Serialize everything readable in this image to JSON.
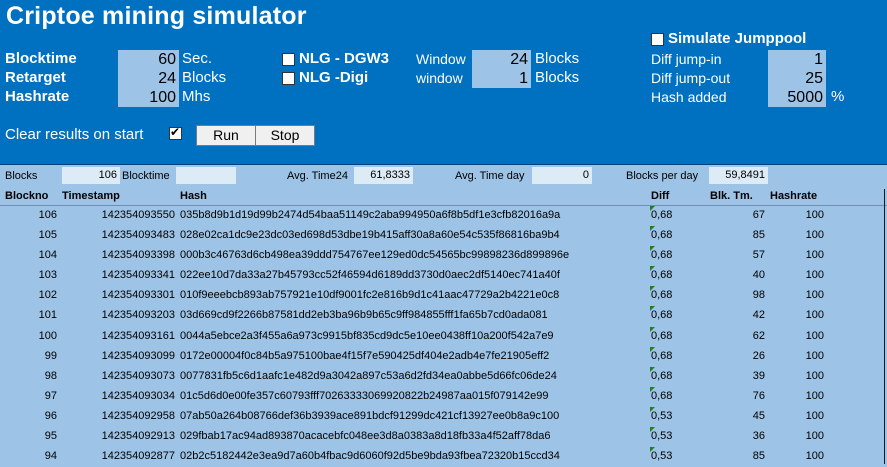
{
  "header": {
    "title": "Criptoe mining simulator"
  },
  "params": {
    "blocktime": {
      "label": "Blocktime",
      "value": "60",
      "unit": "Sec."
    },
    "retarget": {
      "label": "Retarget",
      "value": "24",
      "unit": "Blocks"
    },
    "hashrate": {
      "label": "Hashrate",
      "value": "100",
      "unit": "Mhs"
    }
  },
  "algos": {
    "dgw3": {
      "label": "NLG - DGW3",
      "checked": false,
      "window_label": "Window",
      "window_value": "24",
      "window_unit": "Blocks"
    },
    "digi": {
      "label": "NLG -Digi",
      "checked": false,
      "window_label": "window",
      "window_value": "1",
      "window_unit": "Blocks"
    }
  },
  "jumppool": {
    "label": "Simulate Jumppool",
    "checked": false,
    "jump_in_label": "Diff jump-in",
    "jump_in_value": "1",
    "jump_out_label": "Diff jump-out",
    "jump_out_value": "25",
    "hash_added_label": "Hash added",
    "hash_added_value": "5000",
    "hash_added_unit": "%"
  },
  "controls": {
    "clear_label": "Clear results on start",
    "clear_checked": true,
    "run_label": "Run",
    "stop_label": "Stop"
  },
  "stats": {
    "blocks_label": "Blocks",
    "blocks_value": "106",
    "blocktime_label": "Blocktime",
    "blocktime_value": "",
    "avg24_label": "Avg. Time24",
    "avg24_value": "61,8333",
    "avgday_label": "Avg. Time day",
    "avgday_value": "0",
    "bpd_label": "Blocks per day",
    "bpd_value": "59,8491"
  },
  "table": {
    "columns": [
      "Blockno",
      "Timestamp",
      "Hash",
      "Diff",
      "Blk. Tm.",
      "Hashrate"
    ],
    "rows": [
      [
        "106",
        "142354093550",
        "035b8d9b1d19d99b2474d54baa51149c2aba994950a6f8b5df1e3cfb82016a9a",
        "0,68",
        "67",
        "100"
      ],
      [
        "105",
        "142354093483",
        "028e02ca1dc9e23dc03ed698d53dbe19b415aff30a8a60e54c535f86816ba9b4",
        "0,68",
        "85",
        "100"
      ],
      [
        "104",
        "142354093398",
        "000b3c46763d6cb498ea39ddd754767ee129ed0dc54565bc99898236d899896e",
        "0,68",
        "57",
        "100"
      ],
      [
        "103",
        "142354093341",
        "022ee10d7da33a27b45793cc52f46594d6189dd3730d0aec2df5140ec741a40f",
        "0,68",
        "40",
        "100"
      ],
      [
        "102",
        "142354093301",
        "010f9eeebcb893ab757921e10df9001fc2e816b9d1c41aac47729a2b4221e0c8",
        "0,68",
        "98",
        "100"
      ],
      [
        "101",
        "142354093203",
        "03d669cd9f2266b87581dd2eb3ba96b9b65c9ff984855fff1fa65b7cd0ada081",
        "0,68",
        "42",
        "100"
      ],
      [
        "100",
        "142354093161",
        "0044a5ebce2a3f455a6a973c9915bf835cd9dc5e10ee0438ff10a200f542a7e9",
        "0,68",
        "62",
        "100"
      ],
      [
        "99",
        "142354093099",
        "0172e00004f0c84b5a975100bae4f15f7e590425df404e2adb4e7fe21905eff2",
        "0,68",
        "26",
        "100"
      ],
      [
        "98",
        "142354093073",
        "0077831fb5c6d1aafc1e482d9a3042a897c53a6d2fd34ea0abbe5d66fc06de24",
        "0,68",
        "39",
        "100"
      ],
      [
        "97",
        "142354093034",
        "01c5d6d0e00fe357c60793fff70263333069920822b24987aa015f079142e99",
        "0,68",
        "76",
        "100"
      ],
      [
        "96",
        "142354092958",
        "07ab50a264b08766def36b3939ace891bdcf91299dc421cf13927ee0b8a9c100",
        "0,53",
        "45",
        "100"
      ],
      [
        "95",
        "142354092913",
        "029fbab17ac94ad893870acacebfc048ee3d8a0383a8d18fb33a4f52aff78da6",
        "0,53",
        "36",
        "100"
      ],
      [
        "94",
        "142354092877",
        "02b2c5182442e3ea9d7a60b4fbac9d6060f92d5be9bda93fbea72320b15ccd34",
        "0,53",
        "85",
        "100"
      ]
    ]
  },
  "colors": {
    "panel_blue": "#0070c0",
    "cell_blue": "#9dc3e6",
    "light_blue": "#ddebf7",
    "marker_green": "#1f7f1f"
  }
}
